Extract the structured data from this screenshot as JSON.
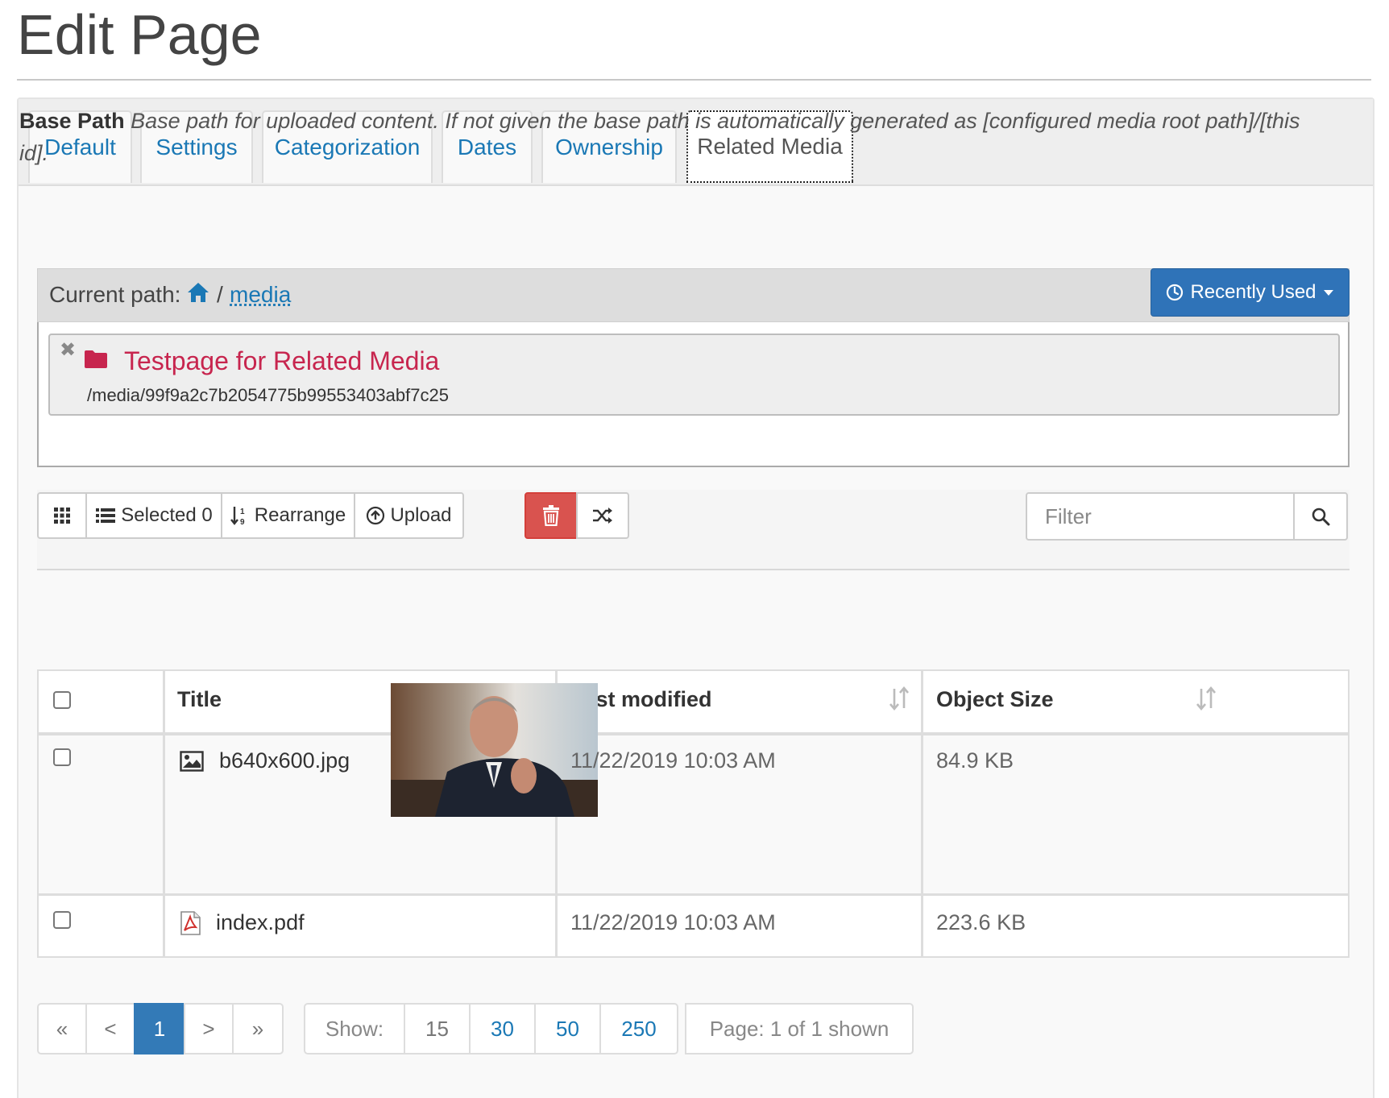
{
  "page": {
    "title": "Edit Page"
  },
  "tabs": [
    "Default",
    "Settings",
    "Categorization",
    "Dates",
    "Ownership",
    "Related Media"
  ],
  "active_tab": "Related Media",
  "base_path": {
    "label": "Base Path",
    "help": "Base path for uploaded content. If not given the base path is automatically generated as [configured media root path]/[this id]."
  },
  "path_bar": {
    "label": "Current path:",
    "separator": "/",
    "segment": "media",
    "recent_button": "Recently Used"
  },
  "selected_item": {
    "name": "Testpage for Related Media",
    "path": "/media/99f9a2c7b2054775b99553403abf7c25",
    "remove_glyph": "✖"
  },
  "toolbar": {
    "selected_label": "Selected 0",
    "rearrange_label": "Rearrange",
    "upload_label": "Upload",
    "filter_placeholder": "Filter"
  },
  "table": {
    "headers": [
      "Title",
      "Last modified",
      "Object Size"
    ],
    "rows": [
      {
        "title": "b640x600.jpg",
        "modified": "11/22/2019 10:03 AM",
        "size": "84.9 KB",
        "icon": "image-icon"
      },
      {
        "title": "index.pdf",
        "modified": "11/22/2019 10:03 AM",
        "size": "223.6 KB",
        "icon": "pdf-icon"
      }
    ]
  },
  "pager": {
    "first": "«",
    "prev": "<",
    "current": "1",
    "next": ">",
    "last": "»",
    "show_label": "Show:",
    "page_sizes": [
      "15",
      "30",
      "50",
      "250"
    ],
    "status": "Page: 1 of 1 shown"
  },
  "colors": {
    "link": "#1a78b5",
    "primary": "#337ab7",
    "danger": "#d9534f",
    "folder": "#c7254e"
  }
}
